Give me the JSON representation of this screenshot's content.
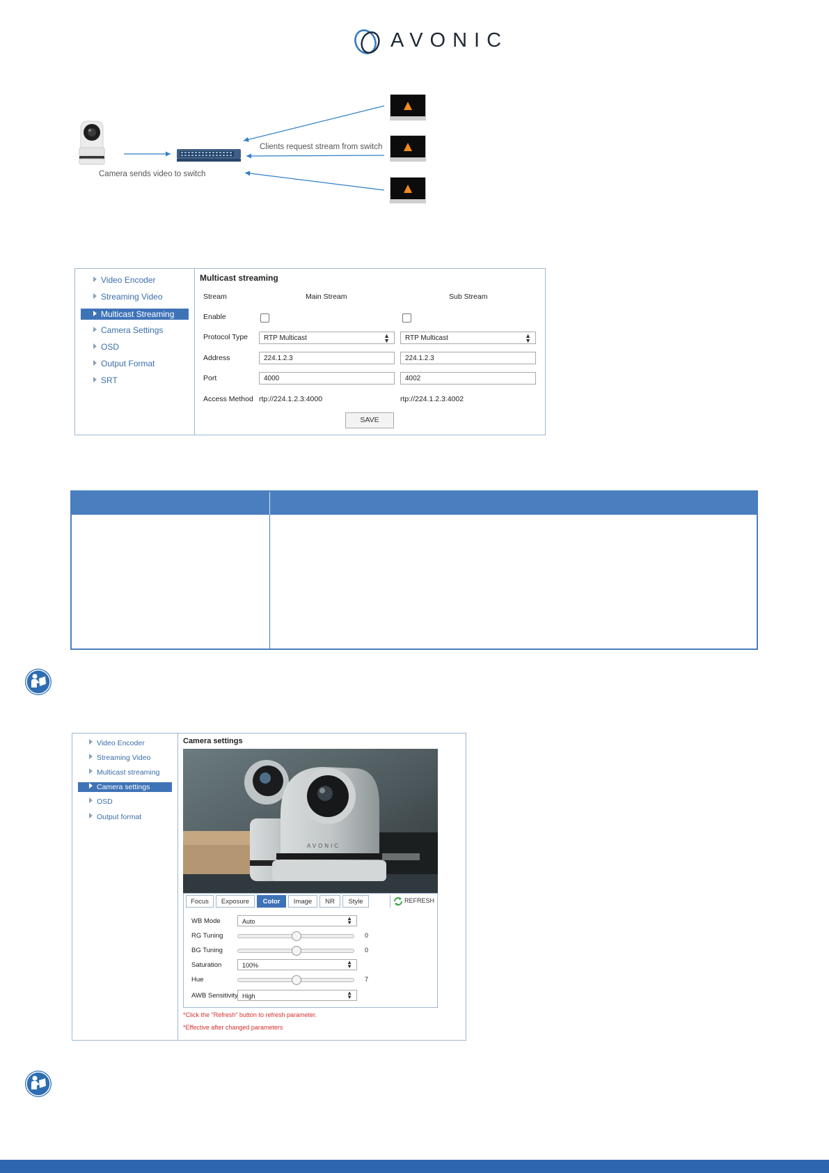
{
  "logo": {
    "text": "AVONIC"
  },
  "diagram": {
    "camera_caption": "Camera sends video to switch",
    "clients_caption": "Clients request stream from switch"
  },
  "multicast_panel": {
    "sidebar": [
      {
        "label": "Video Encoder",
        "active": false
      },
      {
        "label": "Streaming Video",
        "active": false
      },
      {
        "label": "Multicast Streaming",
        "active": true
      },
      {
        "label": "Camera Settings",
        "active": false
      },
      {
        "label": "OSD",
        "active": false
      },
      {
        "label": "Output Format",
        "active": false
      },
      {
        "label": "SRT",
        "active": false
      }
    ],
    "title": "Multicast streaming",
    "col_stream": "Stream",
    "col_main": "Main Stream",
    "col_sub": "Sub Stream",
    "enable_label": "Enable",
    "protocol_label": "Protocol Type",
    "address_label": "Address",
    "port_label": "Port",
    "access_label": "Access Method",
    "main": {
      "protocol": "RTP Multicast",
      "address": "224.1.2.3",
      "port": "4000",
      "access": "rtp://224.1.2.3:4000"
    },
    "sub": {
      "protocol": "RTP Multicast",
      "address": "224.1.2.3",
      "port": "4002",
      "access": "rtp://224.1.2.3:4002"
    },
    "save_label": "SAVE"
  },
  "camera_panel": {
    "sidebar": [
      {
        "label": "Video Encoder",
        "active": false
      },
      {
        "label": "Streaming Video",
        "active": false
      },
      {
        "label": "Multicast streaming",
        "active": false
      },
      {
        "label": "Camera settings",
        "active": true
      },
      {
        "label": "OSD",
        "active": false
      },
      {
        "label": "Output format",
        "active": false
      }
    ],
    "title": "Camera settings",
    "preview_brand": "AVONIC",
    "tabs": [
      "Focus",
      "Exposure",
      "Color",
      "Image",
      "NR",
      "Style"
    ],
    "active_tab": "Color",
    "refresh_label": "REFRESH",
    "wb_mode_label": "WB Mode",
    "wb_mode_value": "Auto",
    "rg_label": "RG Tuning",
    "rg_value": "0",
    "bg_label": "BG Tuning",
    "bg_value": "0",
    "saturation_label": "Saturation",
    "saturation_value": "100%",
    "hue_label": "Hue",
    "hue_value": "7",
    "awb_label": "AWB Sensitivity",
    "awb_value": "High",
    "note_refresh": "*Click the \"Refresh\" button to refresh parameter.",
    "note_effective": "*Effective after changed parameters"
  },
  "colors": {
    "brand_blue": "#2e67b0",
    "table_blue": "#4a7ebf",
    "active_item": "#3f73b8",
    "link_text": "#3b6ea8",
    "note_red": "#d6302f",
    "vlc_orange": "#f18a1e"
  }
}
